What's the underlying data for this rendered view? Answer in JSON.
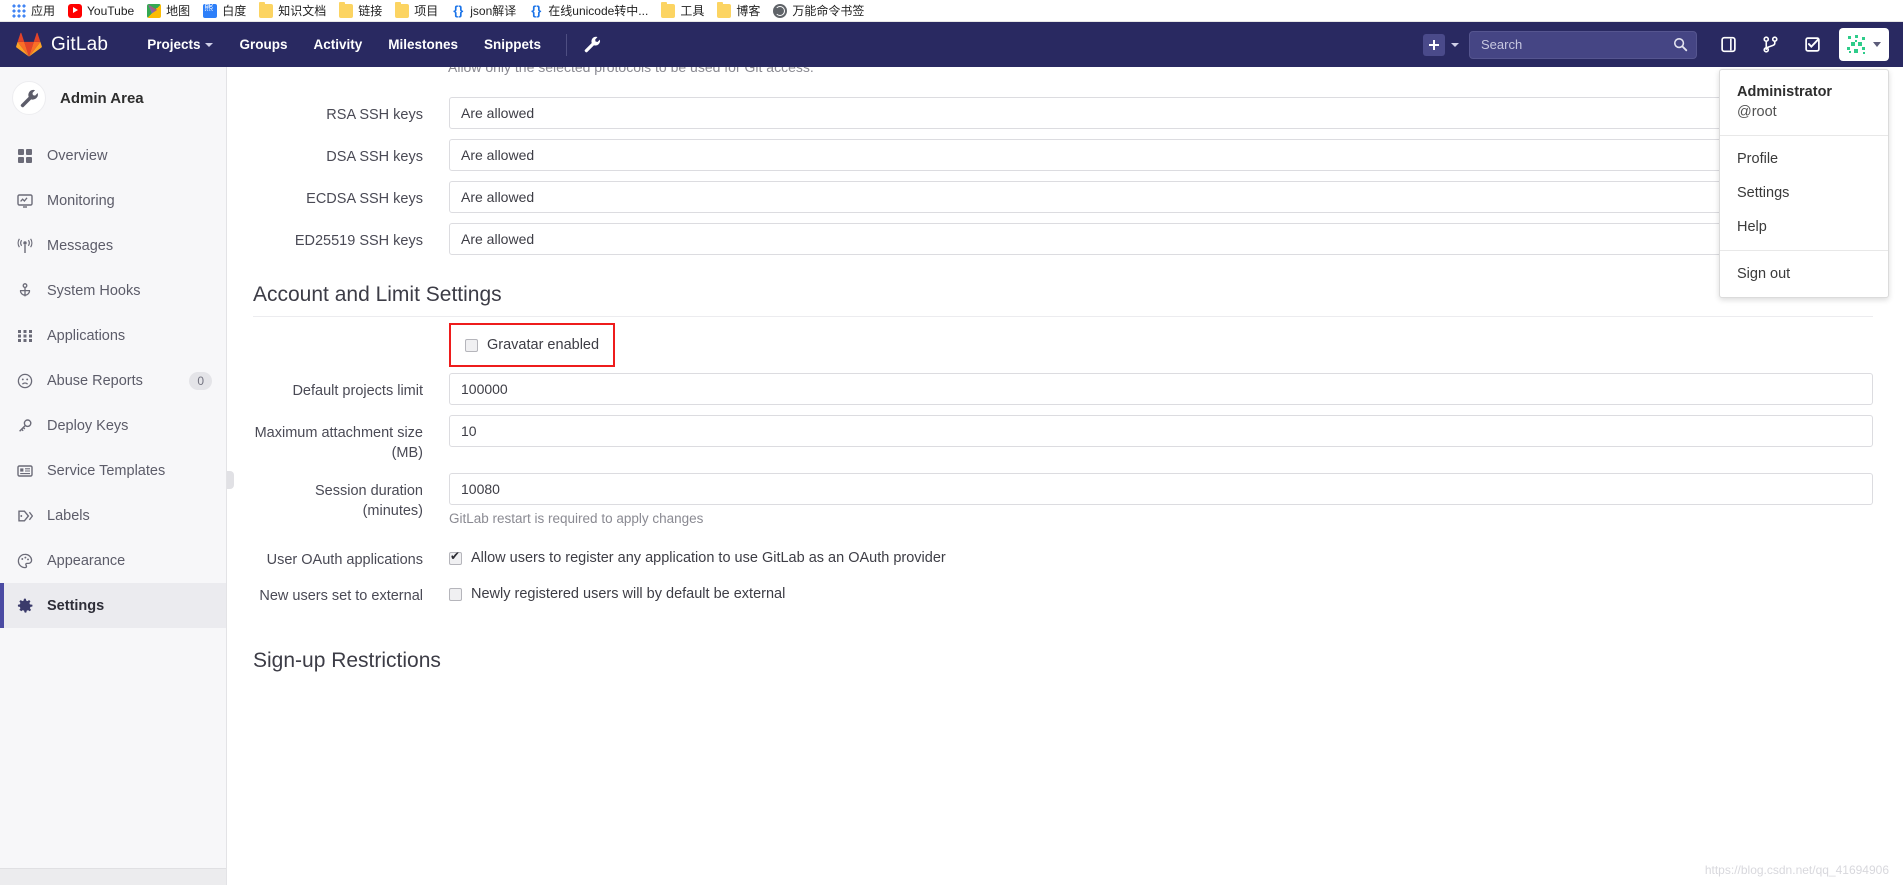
{
  "browser": {
    "bookmarks": [
      {
        "label": "应用",
        "icon": "apps-grid-icon"
      },
      {
        "label": "YouTube",
        "icon": "youtube-icon"
      },
      {
        "label": "地图",
        "icon": "maps-icon"
      },
      {
        "label": "白度",
        "icon": "baidu-icon"
      },
      {
        "label": "知识文档",
        "icon": "folder-icon"
      },
      {
        "label": "链接",
        "icon": "folder-icon"
      },
      {
        "label": "项目",
        "icon": "folder-icon"
      },
      {
        "label": "json解译",
        "icon": "json-icon"
      },
      {
        "label": "在线unicode转中...",
        "icon": "json-icon"
      },
      {
        "label": "工具",
        "icon": "folder-icon"
      },
      {
        "label": "博客",
        "icon": "folder-icon"
      },
      {
        "label": "万能命令书签",
        "icon": "globe-icon"
      }
    ]
  },
  "navbar": {
    "brand": "GitLab",
    "links": [
      {
        "label": "Projects",
        "has_caret": true
      },
      {
        "label": "Groups",
        "has_caret": false
      },
      {
        "label": "Activity",
        "has_caret": false
      },
      {
        "label": "Milestones",
        "has_caret": false
      },
      {
        "label": "Snippets",
        "has_caret": false
      }
    ],
    "admin_wrench_icon": "wrench-icon",
    "plus_icon": "plus-square-icon",
    "search": {
      "placeholder": "Search",
      "value": "",
      "icon": "search-icon"
    },
    "icons": [
      {
        "name": "issue-boards-icon"
      },
      {
        "name": "merge-requests-icon"
      },
      {
        "name": "todos-icon"
      }
    ],
    "avatar_icon": "user-avatar"
  },
  "user_dropdown": {
    "name": "Administrator",
    "handle": "@root",
    "items": [
      "Profile",
      "Settings",
      "Help"
    ],
    "sign_out": "Sign out"
  },
  "sidebar": {
    "title": "Admin Area",
    "header_icon": "wrench-icon",
    "items": [
      {
        "label": "Overview",
        "icon": "grid-icon",
        "active": false,
        "badge": null
      },
      {
        "label": "Monitoring",
        "icon": "monitor-icon",
        "active": false,
        "badge": null
      },
      {
        "label": "Messages",
        "icon": "broadcast-icon",
        "active": false,
        "badge": null
      },
      {
        "label": "System Hooks",
        "icon": "hook-icon",
        "active": false,
        "badge": null
      },
      {
        "label": "Applications",
        "icon": "apps-icon",
        "active": false,
        "badge": null
      },
      {
        "label": "Abuse Reports",
        "icon": "frown-icon",
        "active": false,
        "badge": "0"
      },
      {
        "label": "Deploy Keys",
        "icon": "key-icon",
        "active": false,
        "badge": null
      },
      {
        "label": "Service Templates",
        "icon": "template-icon",
        "active": false,
        "badge": null
      },
      {
        "label": "Labels",
        "icon": "label-icon",
        "active": false,
        "badge": null
      },
      {
        "label": "Appearance",
        "icon": "palette-icon",
        "active": false,
        "badge": null
      },
      {
        "label": "Settings",
        "icon": "gear-icon",
        "active": true,
        "badge": null
      }
    ]
  },
  "main": {
    "clipped_help_text": "Allow only the selected protocols to be used for Git access.",
    "ssh_rows": [
      {
        "label": "RSA SSH keys",
        "value": "Are allowed"
      },
      {
        "label": "DSA SSH keys",
        "value": "Are allowed"
      },
      {
        "label": "ECDSA SSH keys",
        "value": "Are allowed"
      },
      {
        "label": "ED25519 SSH keys",
        "value": "Are allowed"
      }
    ],
    "account_section": {
      "title": "Account and Limit Settings",
      "gravatar": {
        "label": "Gravatar enabled",
        "checked": false,
        "highlighted": true
      },
      "fields": [
        {
          "label": "Default projects limit",
          "value": "100000",
          "help": null
        },
        {
          "label": "Maximum attachment size (MB)",
          "value": "10",
          "help": null
        },
        {
          "label": "Session duration (minutes)",
          "value": "10080",
          "help": "GitLab restart is required to apply changes"
        }
      ],
      "checkboxes": [
        {
          "label": "User OAuth applications",
          "text": "Allow users to register any application to use GitLab as an OAuth provider",
          "checked": true
        },
        {
          "label": "New users set to external",
          "text": "Newly registered users will by default be external",
          "checked": false
        }
      ]
    },
    "signup_section_title": "Sign-up Restrictions",
    "watermark": "https://blog.csdn.net/qq_41694906"
  },
  "colors": {
    "navbar_bg": "#292961",
    "active_accent": "#4b4ba3",
    "highlight_border": "#ee1c1c",
    "sidebar_bg": "#f7f7f9"
  }
}
